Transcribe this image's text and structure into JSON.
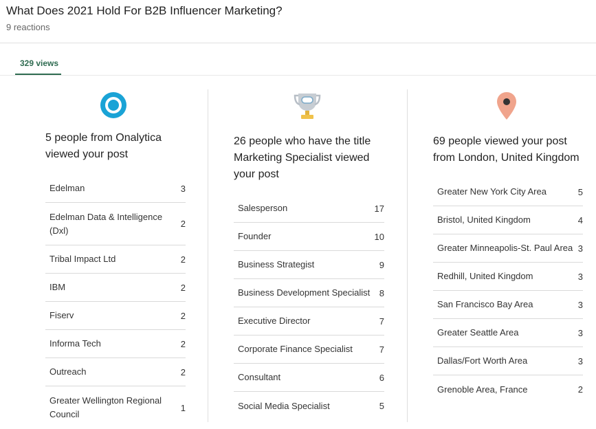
{
  "post": {
    "title": "What Does 2021 Hold For B2B Influencer Marketing?",
    "reactions": "9 reactions"
  },
  "tabs": [
    {
      "label": "329 views",
      "active": true
    }
  ],
  "colors": {
    "accent": "#2e6b50",
    "ring": "#1aa3d6",
    "pin": "#f0a48c"
  },
  "columns": [
    {
      "icon": "circle-ring-icon",
      "heading": [
        "5 people from Onalytica",
        "viewed your post"
      ],
      "rows": [
        {
          "label": "Edelman",
          "count": "3"
        },
        {
          "label": "Edelman Data & Intelligence (Dxl)",
          "count": "2"
        },
        {
          "label": "Tribal Impact Ltd",
          "count": "2"
        },
        {
          "label": "IBM",
          "count": "2"
        },
        {
          "label": "Fiserv",
          "count": "2"
        },
        {
          "label": "Informa Tech",
          "count": "2"
        },
        {
          "label": "Outreach",
          "count": "2"
        },
        {
          "label": "Greater Wellington Regional Council",
          "count": "1"
        }
      ]
    },
    {
      "icon": "trophy-icon",
      "heading": [
        "26 people who have the title",
        "Marketing Specialist viewed",
        "your post"
      ],
      "rows": [
        {
          "label": "Salesperson",
          "count": "17"
        },
        {
          "label": "Founder",
          "count": "10"
        },
        {
          "label": "Business Strategist",
          "count": "9"
        },
        {
          "label": "Business Development Specialist",
          "count": "8"
        },
        {
          "label": "Executive Director",
          "count": "7"
        },
        {
          "label": "Corporate Finance Specialist",
          "count": "7"
        },
        {
          "label": "Consultant",
          "count": "6"
        },
        {
          "label": "Social Media Specialist",
          "count": "5"
        }
      ]
    },
    {
      "icon": "location-pin-icon",
      "heading": [
        "69 people viewed your post",
        "from London, United Kingdom"
      ],
      "rows": [
        {
          "label": "Greater New York City Area",
          "count": "5"
        },
        {
          "label": "Bristol, United Kingdom",
          "count": "4"
        },
        {
          "label": "Greater Minneapolis-St. Paul Area",
          "count": "3"
        },
        {
          "label": "Redhill, United Kingdom",
          "count": "3"
        },
        {
          "label": "San Francisco Bay Area",
          "count": "3"
        },
        {
          "label": "Greater Seattle Area",
          "count": "3"
        },
        {
          "label": "Dallas/Fort Worth Area",
          "count": "3"
        },
        {
          "label": "Grenoble Area, France",
          "count": "2"
        }
      ]
    }
  ]
}
